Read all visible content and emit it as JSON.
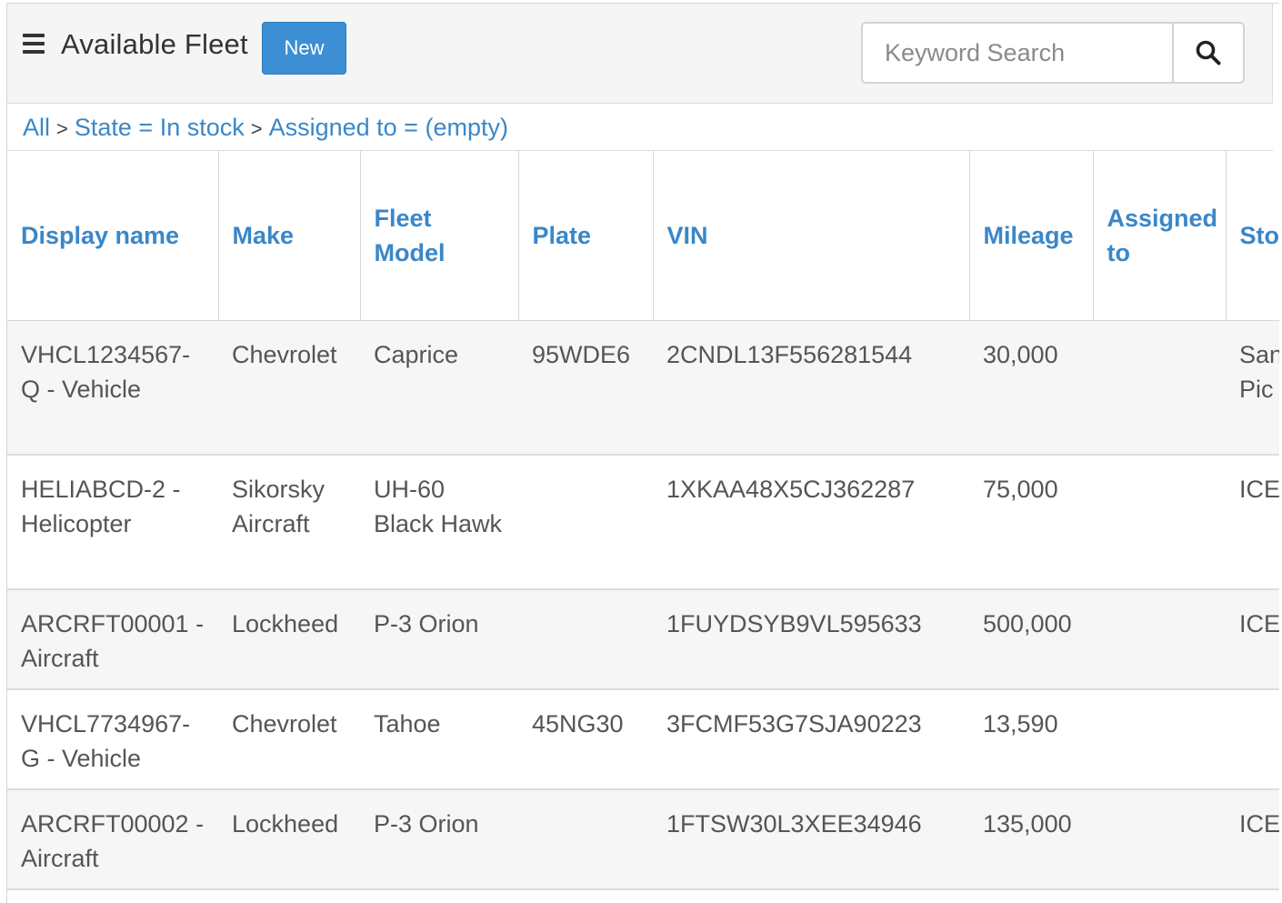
{
  "header": {
    "title": "Available Fleet",
    "new_label": "New",
    "search_placeholder": "Keyword Search"
  },
  "breadcrumb": {
    "items": [
      "All",
      "State = In stock",
      "Assigned to = (empty)"
    ],
    "separator": ">"
  },
  "table": {
    "columns": [
      "Display name",
      "Make",
      "Fleet Model",
      "Plate",
      "VIN",
      "Mileage",
      "Assigned to",
      "Sto"
    ],
    "rows": [
      {
        "display_name": "VHCL1234567-Q - Vehicle",
        "make": "Chevrolet",
        "model": "Caprice",
        "plate": "95WDE6",
        "vin": "2CNDL13F556281544",
        "mileage": "30,000",
        "assigned_to": "",
        "stockroom": "San Bor Pic"
      },
      {
        "display_name": "HELIABCD-2 - Helicopter",
        "make": "Sikorsky Aircraft",
        "model": "UH-60 Black Hawk",
        "plate": "",
        "vin": "1XKAA48X5CJ362287",
        "mileage": "75,000",
        "assigned_to": "",
        "stockroom": "ICE"
      },
      {
        "display_name": "ARCRFT00001 - Aircraft",
        "make": "Lockheed",
        "model": "P-3 Orion",
        "plate": "",
        "vin": "1FUYDSYB9VL595633",
        "mileage": "500,000",
        "assigned_to": "",
        "stockroom": "ICE"
      },
      {
        "display_name": "VHCL7734967-G - Vehicle",
        "make": "Chevrolet",
        "model": "Tahoe",
        "plate": "45NG30",
        "vin": "3FCMF53G7SJA90223",
        "mileage": "13,590",
        "assigned_to": "",
        "stockroom": ""
      },
      {
        "display_name": "ARCRFT00002 - Aircraft",
        "make": "Lockheed",
        "model": "P-3 Orion",
        "plate": "",
        "vin": "1FTSW30L3XEE34946",
        "mileage": "135,000",
        "assigned_to": "",
        "stockroom": "ICE"
      }
    ]
  },
  "icons": {
    "menu": "hamburger-menu-icon",
    "search": "magnifier-icon"
  },
  "colors": {
    "accent": "#3a87c8",
    "button": "#3c8fd4",
    "header_bg": "#f5f5f5",
    "row_alt": "#f6f6f6"
  }
}
